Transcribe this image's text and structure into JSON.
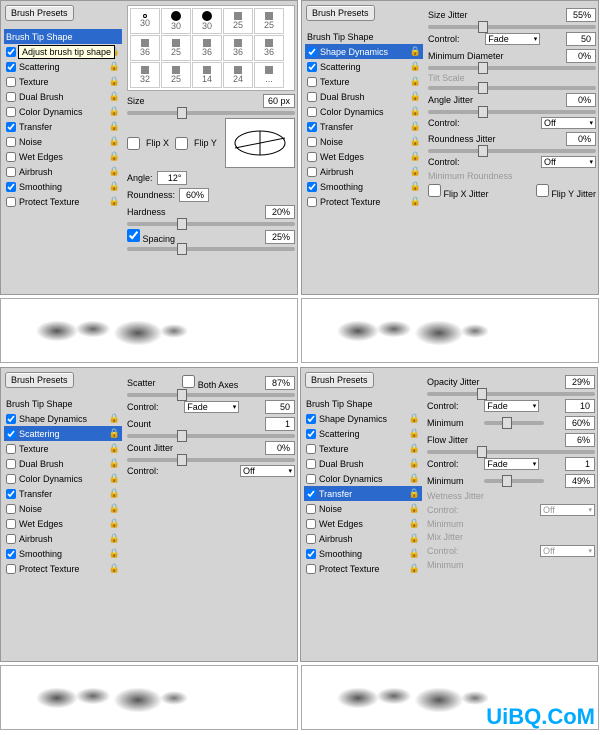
{
  "common": {
    "brushPresets": "Brush Presets",
    "brushTipShape": "Brush Tip Shape",
    "tooltip": "Adjust brush tip shape",
    "options": [
      "Shape Dynamics",
      "Scattering",
      "Texture",
      "Dual Brush",
      "Color Dynamics",
      "Transfer",
      "Noise",
      "Wet Edges",
      "Airbrush",
      "Smoothing",
      "Protect Texture"
    ],
    "control": "Control:",
    "fade": "Fade",
    "off": "Off"
  },
  "q1": {
    "checked": [
      true,
      true,
      false,
      false,
      false,
      true,
      false,
      false,
      false,
      true,
      false
    ],
    "swatches": [
      "30",
      "30",
      "30",
      "25",
      "25",
      "36",
      "25",
      "36",
      "36",
      "36",
      "32",
      "25",
      "14",
      "24",
      "..."
    ],
    "sizeLabel": "Size",
    "size": "60 px",
    "flipX": "Flip X",
    "flipY": "Flip Y",
    "angleLabel": "Angle:",
    "angle": "12°",
    "roundLabel": "Roundness:",
    "round": "60%",
    "hardLabel": "Hardness",
    "hard": "20%",
    "spacingLabel": "Spacing",
    "spacing": "25%"
  },
  "q2": {
    "checked": [
      true,
      true,
      false,
      false,
      false,
      true,
      false,
      false,
      false,
      true,
      false
    ],
    "sel": 0,
    "sizeJitter": "Size Jitter",
    "sizeJitterV": "55%",
    "fadeV": "50",
    "minDia": "Minimum Diameter",
    "minDiaV": "0%",
    "tilt": "Tilt Scale",
    "angleJitter": "Angle Jitter",
    "angleJitterV": "0%",
    "roundJitter": "Roundness Jitter",
    "roundJitterV": "0%",
    "minRound": "Minimum Roundness",
    "flipXJ": "Flip X Jitter",
    "flipYJ": "Flip Y Jitter"
  },
  "q3": {
    "checked": [
      true,
      true,
      false,
      false,
      false,
      true,
      false,
      false,
      false,
      true,
      false
    ],
    "sel": 1,
    "scatter": "Scatter",
    "both": "Both Axes",
    "scatterV": "87%",
    "fadeV": "50",
    "count": "Count",
    "countV": "1",
    "countJ": "Count Jitter",
    "countJV": "0%"
  },
  "q4": {
    "checked": [
      true,
      true,
      false,
      false,
      false,
      true,
      false,
      false,
      false,
      true,
      false
    ],
    "sel": 5,
    "opJitter": "Opacity Jitter",
    "opJitterV": "29%",
    "opFade": "10",
    "opMin": "Minimum",
    "opMinV": "60%",
    "flowJ": "Flow Jitter",
    "flowJV": "6%",
    "flowFade": "1",
    "flowMin": "Minimum",
    "flowMinV": "49%",
    "wetJ": "Wetness Jitter",
    "mixJ": "Mix Jitter",
    "min": "Minimum"
  },
  "watermark": "UiBQ.CoM"
}
